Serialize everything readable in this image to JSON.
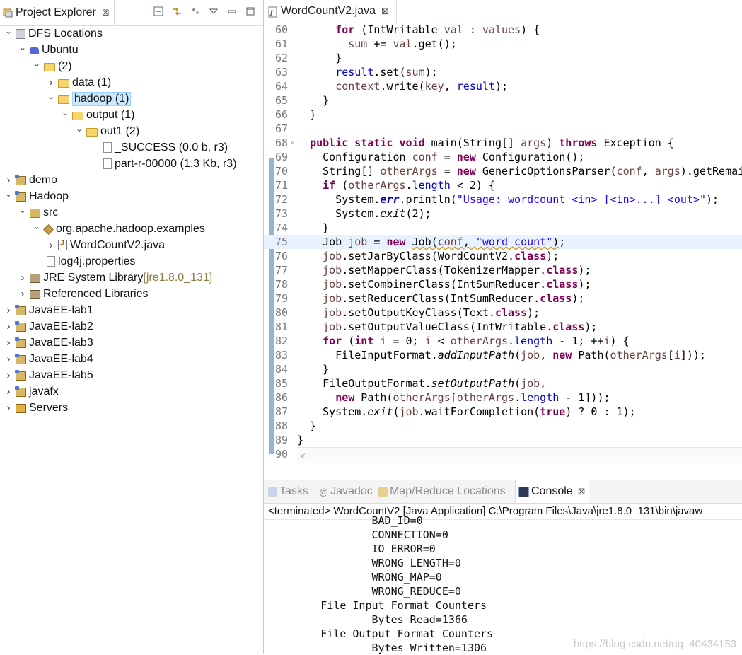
{
  "project_explorer": {
    "tab_title": "Project Explorer",
    "close_glyph": "⊠",
    "toolbar": [
      "collapse-all-icon",
      "link-with-editor-icon",
      "focus-icon",
      "view-menu-icon",
      "minimize-icon",
      "maximize-icon"
    ],
    "tree": [
      {
        "label": "DFS Locations",
        "suffix": "",
        "depth": 0,
        "expanded": true,
        "icon": "dfs-icon"
      },
      {
        "label": "Ubuntu",
        "suffix": "",
        "depth": 1,
        "expanded": true,
        "icon": "hadoop-elephant-icon"
      },
      {
        "label": " (2)",
        "suffix": "",
        "depth": 2,
        "expanded": true,
        "icon": "folder-icon"
      },
      {
        "label": "data (1)",
        "suffix": "",
        "depth": 3,
        "expanded": false,
        "icon": "folder-icon"
      },
      {
        "label": "hadoop (1)",
        "suffix": "",
        "depth": 3,
        "expanded": true,
        "icon": "folder-icon",
        "selected": true
      },
      {
        "label": "output (1)",
        "suffix": "",
        "depth": 4,
        "expanded": true,
        "icon": "folder-icon"
      },
      {
        "label": "out1 (2)",
        "suffix": "",
        "depth": 5,
        "expanded": true,
        "icon": "folder-icon"
      },
      {
        "label": "_SUCCESS (0.0 b, r3)",
        "suffix": "",
        "depth": 6,
        "expanded": null,
        "icon": "file-icon"
      },
      {
        "label": "part-r-00000 (1.3 Kb, r3)",
        "suffix": "",
        "depth": 6,
        "expanded": null,
        "icon": "file-icon"
      },
      {
        "label": "demo",
        "suffix": "",
        "depth": 0,
        "expanded": false,
        "icon": "project-icon"
      },
      {
        "label": "Hadoop",
        "suffix": "",
        "depth": 0,
        "expanded": true,
        "icon": "project-icon"
      },
      {
        "label": "src",
        "suffix": "",
        "depth": 1,
        "expanded": true,
        "icon": "source-folder-icon"
      },
      {
        "label": "org.apache.hadoop.examples",
        "suffix": "",
        "depth": 2,
        "expanded": true,
        "icon": "package-icon"
      },
      {
        "label": "WordCountV2.java",
        "suffix": "",
        "depth": 3,
        "expanded": false,
        "icon": "java-file-icon"
      },
      {
        "label": "log4j.properties",
        "suffix": "",
        "depth": 2,
        "expanded": null,
        "icon": "file-icon"
      },
      {
        "label": "JRE System Library ",
        "suffix": "[jre1.8.0_131]",
        "depth": 1,
        "expanded": false,
        "icon": "library-icon"
      },
      {
        "label": "Referenced Libraries",
        "suffix": "",
        "depth": 1,
        "expanded": false,
        "icon": "library-icon"
      },
      {
        "label": "JavaEE-lab1",
        "suffix": "",
        "depth": 0,
        "expanded": false,
        "icon": "project-icon"
      },
      {
        "label": "JavaEE-lab2",
        "suffix": "",
        "depth": 0,
        "expanded": false,
        "icon": "project-icon"
      },
      {
        "label": "JavaEE-lab3",
        "suffix": "",
        "depth": 0,
        "expanded": false,
        "icon": "project-icon"
      },
      {
        "label": "JavaEE-lab4",
        "suffix": "",
        "depth": 0,
        "expanded": false,
        "icon": "project-icon"
      },
      {
        "label": "JavaEE-lab5",
        "suffix": "",
        "depth": 0,
        "expanded": false,
        "icon": "project-icon"
      },
      {
        "label": "javafx",
        "suffix": "",
        "depth": 0,
        "expanded": false,
        "icon": "project-icon"
      },
      {
        "label": "Servers",
        "suffix": "",
        "depth": 0,
        "expanded": false,
        "icon": "servers-folder-icon"
      }
    ]
  },
  "editor": {
    "tab_title": "WordCountV2.java",
    "close_glyph": "⊠",
    "scroll_hint": "<",
    "current_line": 75,
    "lines": [
      {
        "n": "60",
        "html": "      <span class=\"kw\">for</span> (IntWritable <span class=\"var\">val</span> : <span class=\"var\">values</span>) {"
      },
      {
        "n": "61",
        "html": "        <span class=\"var\">sum</span> += <span class=\"var\">val</span>.get();"
      },
      {
        "n": "62",
        "html": "      }"
      },
      {
        "n": "63",
        "html": "      <span class=\"fld\">result</span>.set(<span class=\"var\">sum</span>);"
      },
      {
        "n": "64",
        "html": "      <span class=\"var\">context</span>.write(<span class=\"var\">key</span>, <span class=\"fld\">result</span>);"
      },
      {
        "n": "65",
        "html": "    }"
      },
      {
        "n": "66",
        "html": "  }"
      },
      {
        "n": "67",
        "html": ""
      },
      {
        "n": "68",
        "html": "  <span class=\"kw\">public static void</span> main(String[] <span class=\"var\">args</span>) <span class=\"kw\">throws</span> Exception {",
        "fold": true
      },
      {
        "n": "69",
        "html": "    Configuration <span class=\"var\">conf</span> = <span class=\"kw\">new</span> Configuration();"
      },
      {
        "n": "70",
        "html": "    String[] <span class=\"var\">otherArgs</span> = <span class=\"kw\">new</span> GenericOptionsParser(<span class=\"var\">conf</span>, <span class=\"var\">args</span>).getRemai"
      },
      {
        "n": "71",
        "html": "    <span class=\"kw\">if</span> (<span class=\"var\">otherArgs</span>.<span class=\"fld\">length</span> &lt; 2) {"
      },
      {
        "n": "72",
        "html": "      System.<span class=\"fldi\">err</span>.println(<span class=\"str\">\"Usage: wordcount &lt;in&gt; [&lt;in&gt;...] &lt;out&gt;\"</span>);"
      },
      {
        "n": "73",
        "html": "      System.<span class=\"mth\">exit</span>(2);"
      },
      {
        "n": "74",
        "html": "    }"
      },
      {
        "n": "75",
        "html": "    Job <span class=\"var\">job</span> = <span class=\"kw\">new</span> <span class=\"strike warn-squiggle\">Job</span><span class=\"warn-squiggle\">(<span class=\"var\">conf</span>, <span class=\"str\">\"word count\"</span>)</span>;",
        "current": true
      },
      {
        "n": "76",
        "html": "    <span class=\"var\">job</span>.setJarByClass(WordCountV2.<span class=\"kw\">class</span>);"
      },
      {
        "n": "77",
        "html": "    <span class=\"var\">job</span>.setMapperClass(TokenizerMapper.<span class=\"kw\">class</span>);"
      },
      {
        "n": "78",
        "html": "    <span class=\"var\">job</span>.setCombinerClass(IntSumReducer.<span class=\"kw\">class</span>);"
      },
      {
        "n": "79",
        "html": "    <span class=\"var\">job</span>.setReducerClass(IntSumReducer.<span class=\"kw\">class</span>);"
      },
      {
        "n": "80",
        "html": "    <span class=\"var\">job</span>.setOutputKeyClass(Text.<span class=\"kw\">class</span>);"
      },
      {
        "n": "81",
        "html": "    <span class=\"var\">job</span>.setOutputValueClass(IntWritable.<span class=\"kw\">class</span>);"
      },
      {
        "n": "82",
        "html": "    <span class=\"kw\">for</span> (<span class=\"kw\">int</span> <span class=\"var\">i</span> = 0; <span class=\"var\">i</span> &lt; <span class=\"var\">otherArgs</span>.<span class=\"fld\">length</span> - 1; ++<span class=\"var\">i</span>) {"
      },
      {
        "n": "83",
        "html": "      FileInputFormat.<span class=\"mth\">addInputPath</span>(<span class=\"var\">job</span>, <span class=\"kw\">new</span> Path(<span class=\"var\">otherArgs</span>[<span class=\"var\">i</span>]));"
      },
      {
        "n": "84",
        "html": "    }"
      },
      {
        "n": "85",
        "html": "    FileOutputFormat.<span class=\"mth\">setOutputPath</span>(<span class=\"var\">job</span>,"
      },
      {
        "n": "86",
        "html": "      <span class=\"kw\">new</span> Path(<span class=\"var\">otherArgs</span>[<span class=\"var\">otherArgs</span>.<span class=\"fld\">length</span> - 1]));"
      },
      {
        "n": "87",
        "html": "    System.<span class=\"mth\">exit</span>(<span class=\"var\">job</span>.waitForCompletion(<span class=\"kw\">true</span>) ? 0 : 1);"
      },
      {
        "n": "88",
        "html": "  }"
      },
      {
        "n": "89",
        "html": "}"
      },
      {
        "n": "90",
        "html": ""
      }
    ]
  },
  "bottom_panel": {
    "tabs": [
      {
        "label": "Tasks",
        "icon": "tasks-icon",
        "active": false
      },
      {
        "label": "Javadoc",
        "icon": "javadoc-icon",
        "active": false
      },
      {
        "label": "Map/Reduce Locations",
        "icon": "elephant-icon",
        "active": false
      },
      {
        "label": "Console",
        "icon": "console-icon",
        "active": true
      }
    ],
    "close_glyph": "⊠",
    "console_header": "<terminated> WordCountV2 [Java Application] C:\\Program Files\\Java\\jre1.8.0_131\\bin\\javaw",
    "console_lines": [
      "                BAD_ID=0",
      "                CONNECTION=0",
      "                IO_ERROR=0",
      "                WRONG_LENGTH=0",
      "                WRONG_MAP=0",
      "                WRONG_REDUCE=0",
      "        File Input Format Counters",
      "                Bytes Read=1366",
      "        File Output Format Counters",
      "                Bytes Written=1306"
    ]
  },
  "watermark": "https://blog.csdn.net/qq_40434153",
  "colors": {
    "keyword": "#7f0055",
    "string": "#2a00ff",
    "field": "#0000c0",
    "selection": "#cce8ff"
  }
}
